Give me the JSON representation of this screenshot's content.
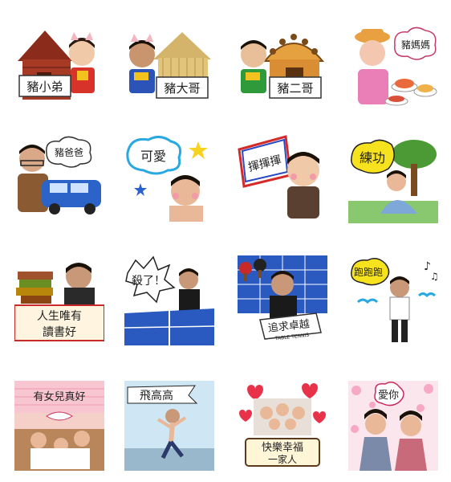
{
  "stickers": [
    {
      "id": "s1",
      "caption": "豬小弟"
    },
    {
      "id": "s2",
      "caption": "豬大哥"
    },
    {
      "id": "s3",
      "caption": "豬二哥"
    },
    {
      "id": "s4",
      "caption": "豬媽媽"
    },
    {
      "id": "s5",
      "caption": "豬爸爸"
    },
    {
      "id": "s6",
      "caption": "可愛"
    },
    {
      "id": "s7",
      "caption": "揮揮揮"
    },
    {
      "id": "s8",
      "caption": "練功"
    },
    {
      "id": "s9",
      "caption_line1": "人生唯有",
      "caption_line2": "讀書好"
    },
    {
      "id": "s10",
      "caption": "殺了！"
    },
    {
      "id": "s11",
      "caption": "追求卓越",
      "subcaption": "TABLE TENNIS"
    },
    {
      "id": "s12",
      "caption": "跑跑跑"
    },
    {
      "id": "s13",
      "caption": "有女兒真好"
    },
    {
      "id": "s14",
      "caption": "飛高高"
    },
    {
      "id": "s15",
      "caption_line1": "快樂幸福",
      "caption_line2": "一家人"
    },
    {
      "id": "s16",
      "caption": "愛你"
    }
  ]
}
